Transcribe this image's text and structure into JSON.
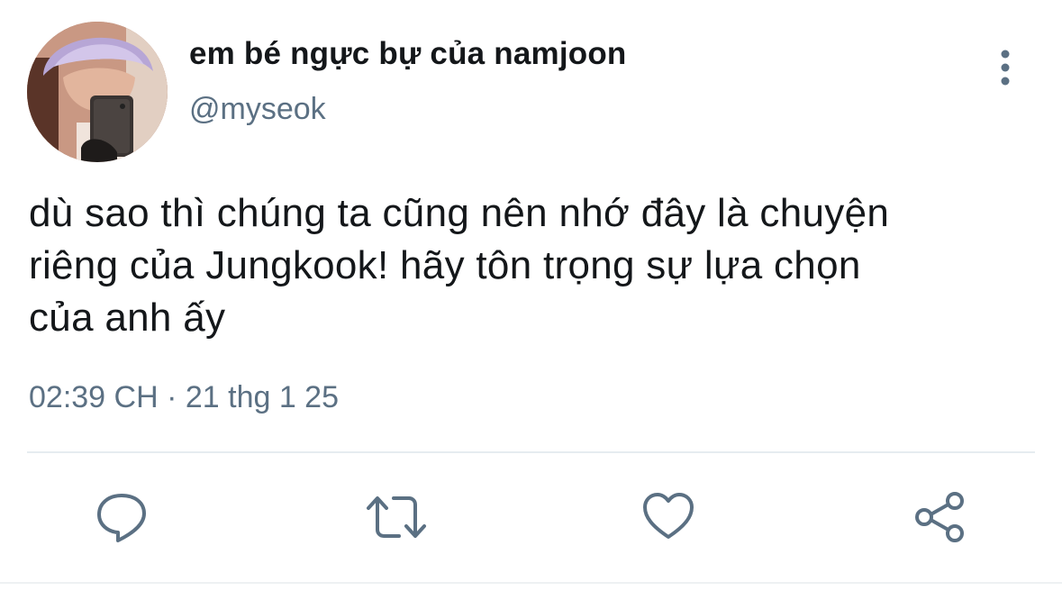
{
  "tweet": {
    "author": {
      "display_name": "em bé ngực bự của namjoon",
      "handle": "@myseok"
    },
    "text_lines": [
      "dù sao thì chúng ta cũng nên nhớ đây là chuyện",
      "riêng của Jungkook! hãy tôn trọng sự lựa chọn",
      "của anh ấy"
    ],
    "timestamp": "02:39 CH · 21 thg 1 25",
    "actions": {
      "reply_icon": "speech-bubble",
      "retweet_icon": "retweet-arrows",
      "like_icon": "heart",
      "share_icon": "share-nodes"
    }
  },
  "colors": {
    "text_primary": "#14171a",
    "text_secondary": "#5b7083",
    "icon": "#5b7083",
    "divider": "#e6ecf0"
  }
}
